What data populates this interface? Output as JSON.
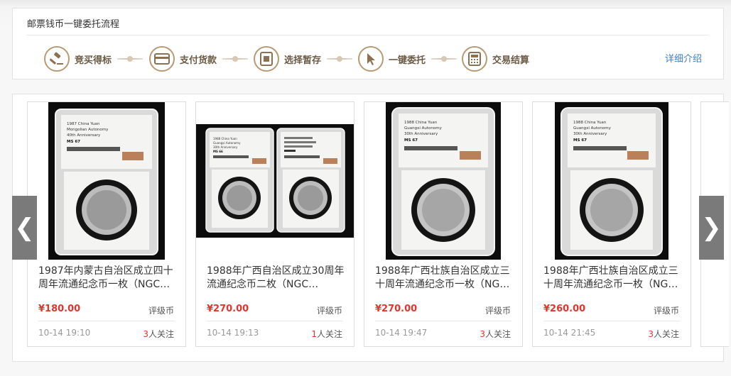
{
  "flow": {
    "title": "邮票钱币一键委托流程",
    "steps": [
      {
        "label": "竞买得标",
        "icon": "gavel-icon"
      },
      {
        "label": "支付货款",
        "icon": "card-icon"
      },
      {
        "label": "选择暂存",
        "icon": "storage-icon"
      },
      {
        "label": "一键委托",
        "icon": "cursor-icon"
      },
      {
        "label": "交易结算",
        "icon": "calculator-icon"
      }
    ],
    "detail_link": "详细介绍"
  },
  "carousel": {
    "prev_label": "❮",
    "next_label": "❯",
    "items": [
      {
        "title": "1987年内蒙古自治区成立四十周年流通纪念币一枚（NGC…",
        "currency": "¥",
        "price": "180.00",
        "category": "评级币",
        "time": "10-14 19:10",
        "followers": "3",
        "follow_suffix": "人关注",
        "slab_text": [
          "1987 China Yuan",
          "Mongolian Autonomy",
          "40th Anniversary",
          "MS 67"
        ]
      },
      {
        "title": "1988年广西自治区成立30周年流通纪念币二枚（NGC…",
        "currency": "¥",
        "price": "270.00",
        "category": "评级币",
        "time": "10-14 19:13",
        "followers": "1",
        "follow_suffix": "人关注",
        "slab_text": [
          "1988 China Yuan",
          "Guangxi Autonomy",
          "30th Anniversary",
          "MS 66"
        ]
      },
      {
        "title": "1988年广西壮族自治区成立三十周年流通纪念币一枚（NG…",
        "currency": "¥",
        "price": "270.00",
        "category": "评级币",
        "time": "10-14 19:47",
        "followers": "3",
        "follow_suffix": "人关注",
        "slab_text": [
          "1988 China Yuan",
          "Guangxi Autonomy",
          "30th Anniversary",
          "MS 67"
        ]
      },
      {
        "title": "1988年广西壮族自治区成立三十周年流通纪念币一枚（NG…",
        "currency": "¥",
        "price": "260.00",
        "category": "评级币",
        "time": "10-14 21:45",
        "followers": "3",
        "follow_suffix": "人关注",
        "slab_text": [
          "1988 China Yuan",
          "Guangxi Autonomy",
          "30th Anniversary",
          "MS 67"
        ]
      }
    ]
  },
  "colors": {
    "accent_gold": "#b79a72",
    "price_red": "#e2352d",
    "link_blue": "#3f7fc7",
    "arrow_gray": "#7a7a7a"
  }
}
